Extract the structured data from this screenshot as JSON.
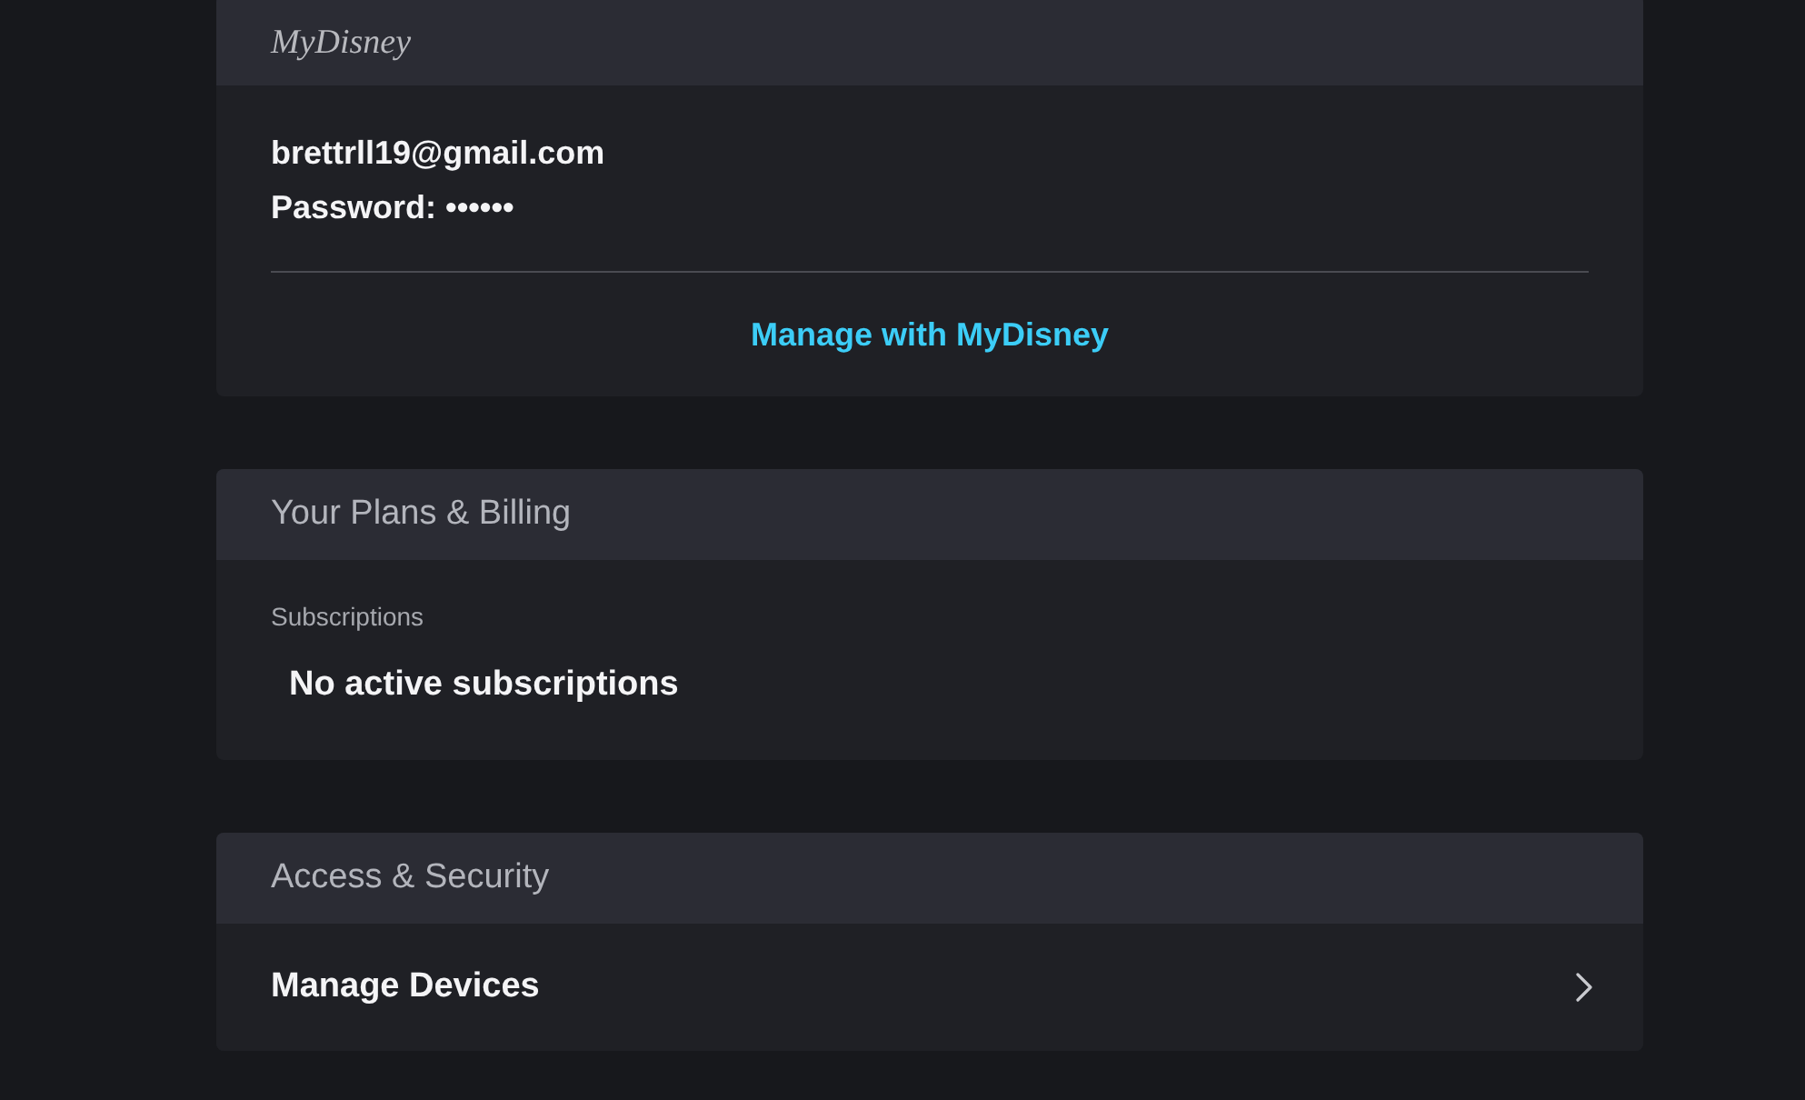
{
  "account": {
    "logo": "MyDisney",
    "email": "brettrll19@gmail.com",
    "password": "Password: ••••••",
    "link": "Manage with MyDisney"
  },
  "plans_billing": {
    "title": "Your Plans & Billing",
    "section_label": "Subscriptions",
    "status": "No active subscriptions"
  },
  "access_security": {
    "title": "Access & Security",
    "items": [
      {
        "label": "Manage Devices"
      }
    ]
  }
}
